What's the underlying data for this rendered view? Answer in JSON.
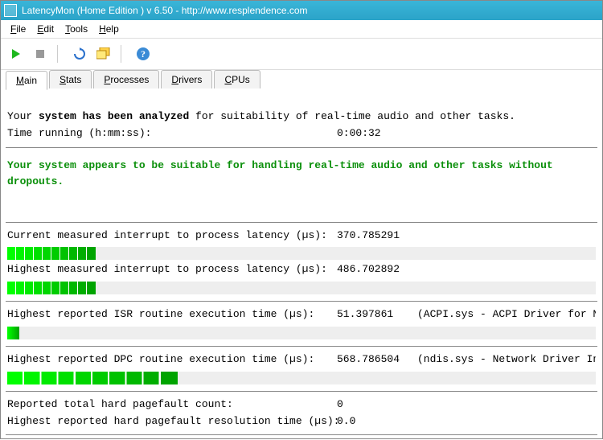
{
  "window": {
    "title": "LatencyMon  (Home Edition )  v 6.50 - http://www.resplendence.com"
  },
  "menu": {
    "file": "File",
    "edit": "Edit",
    "tools": "Tools",
    "help": "Help"
  },
  "tabs": {
    "main": "Main",
    "stats": "Stats",
    "processes": "Processes",
    "drivers": "Drivers",
    "cpus": "CPUs"
  },
  "summary": {
    "line1_prefix": "Your ",
    "line1_bold": "system has been analyzed",
    "line1_suffix": " for suitability of real-time audio and other tasks.",
    "time_label": "Time running (h:mm:ss):",
    "time_value": "0:00:32",
    "verdict": "Your system appears to be suitable for handling real-time audio and other tasks without dropouts."
  },
  "metrics": {
    "current_interrupt_label": "Current measured interrupt to process latency (µs):",
    "current_interrupt_value": "370.785291",
    "highest_interrupt_label": "Highest measured interrupt to process latency (µs):",
    "highest_interrupt_value": "486.702892",
    "highest_isr_label": "Highest reported ISR routine execution time (µs):",
    "highest_isr_value": "51.397861",
    "highest_isr_extra": "(ACPI.sys - ACPI Driver for NT, Microsoft Co",
    "highest_dpc_label": "Highest reported DPC routine execution time (µs):",
    "highest_dpc_value": "568.786504",
    "highest_dpc_extra": "(ndis.sys - Network Driver Interface Specif",
    "pagefault_count_label": "Reported total hard pagefault count:",
    "pagefault_count_value": "0",
    "pagefault_time_label": "Highest reported hard pagefault resolution time (µs):",
    "pagefault_time_value": "0.0"
  },
  "bars": {
    "current_interrupt_pct": 15,
    "highest_interrupt_pct": 15,
    "highest_isr_pct": 2,
    "highest_dpc_pct": 29
  }
}
